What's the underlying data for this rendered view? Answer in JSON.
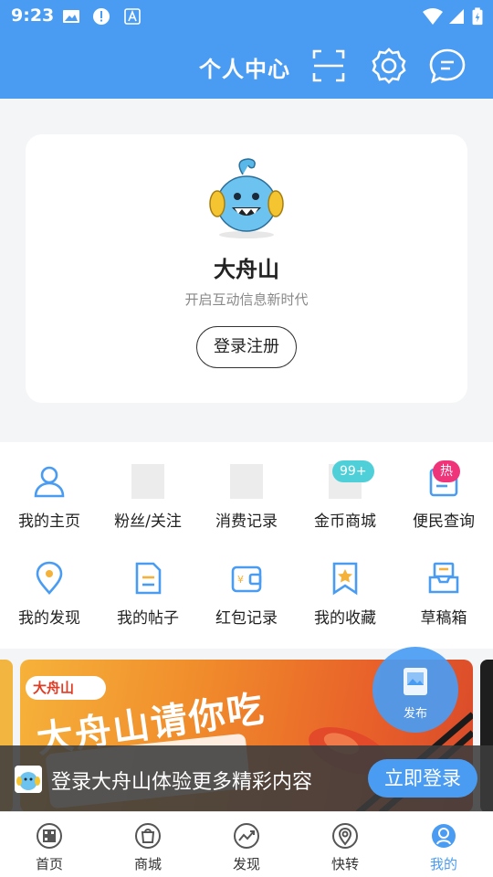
{
  "status_bar": {
    "time": "9:23",
    "icons": [
      "image-icon",
      "alert-icon",
      "font-icon",
      "wifi-icon",
      "signal-icon",
      "battery-icon"
    ]
  },
  "header": {
    "title": "个人中心",
    "actions": [
      "scan-icon",
      "gear-icon",
      "message-icon"
    ]
  },
  "profile": {
    "app_name": "大舟山",
    "slogan": "开启互动信息新时代",
    "login_button": "登录注册"
  },
  "menu": {
    "row1": [
      {
        "label": "我的主页",
        "icon": "user-icon"
      },
      {
        "label": "粉丝/关注",
        "icon": "placeholder"
      },
      {
        "label": "消费记录",
        "icon": "placeholder"
      },
      {
        "label": "金币商城",
        "icon": "placeholder",
        "badge": "99+"
      },
      {
        "label": "便民查询",
        "icon": "phone-query-icon",
        "badge": "热"
      }
    ],
    "row2": [
      {
        "label": "我的发现",
        "icon": "location-pin-icon"
      },
      {
        "label": "我的帖子",
        "icon": "document-icon"
      },
      {
        "label": "红包记录",
        "icon": "wallet-icon"
      },
      {
        "label": "我的收藏",
        "icon": "bookmark-star-icon"
      },
      {
        "label": "草稿箱",
        "icon": "inbox-tray-icon"
      }
    ]
  },
  "banner": {
    "logo_text": "大舟山",
    "headline": "大舟山请你吃"
  },
  "publish_button": {
    "label": "发布"
  },
  "login_bar": {
    "message": "登录大舟山体验更多精彩内容",
    "button": "立即登录"
  },
  "tabbar": [
    {
      "label": "首页",
      "icon": "home-icon"
    },
    {
      "label": "商城",
      "icon": "shopping-bag-icon"
    },
    {
      "label": "发现",
      "icon": "trend-icon"
    },
    {
      "label": "快转",
      "icon": "pin-icon"
    },
    {
      "label": "我的",
      "icon": "profile-icon",
      "active": true
    }
  ],
  "colors": {
    "accent": "#4a9cf3",
    "badge_teal": "#4fd0d8",
    "badge_pink": "#f0347a"
  }
}
